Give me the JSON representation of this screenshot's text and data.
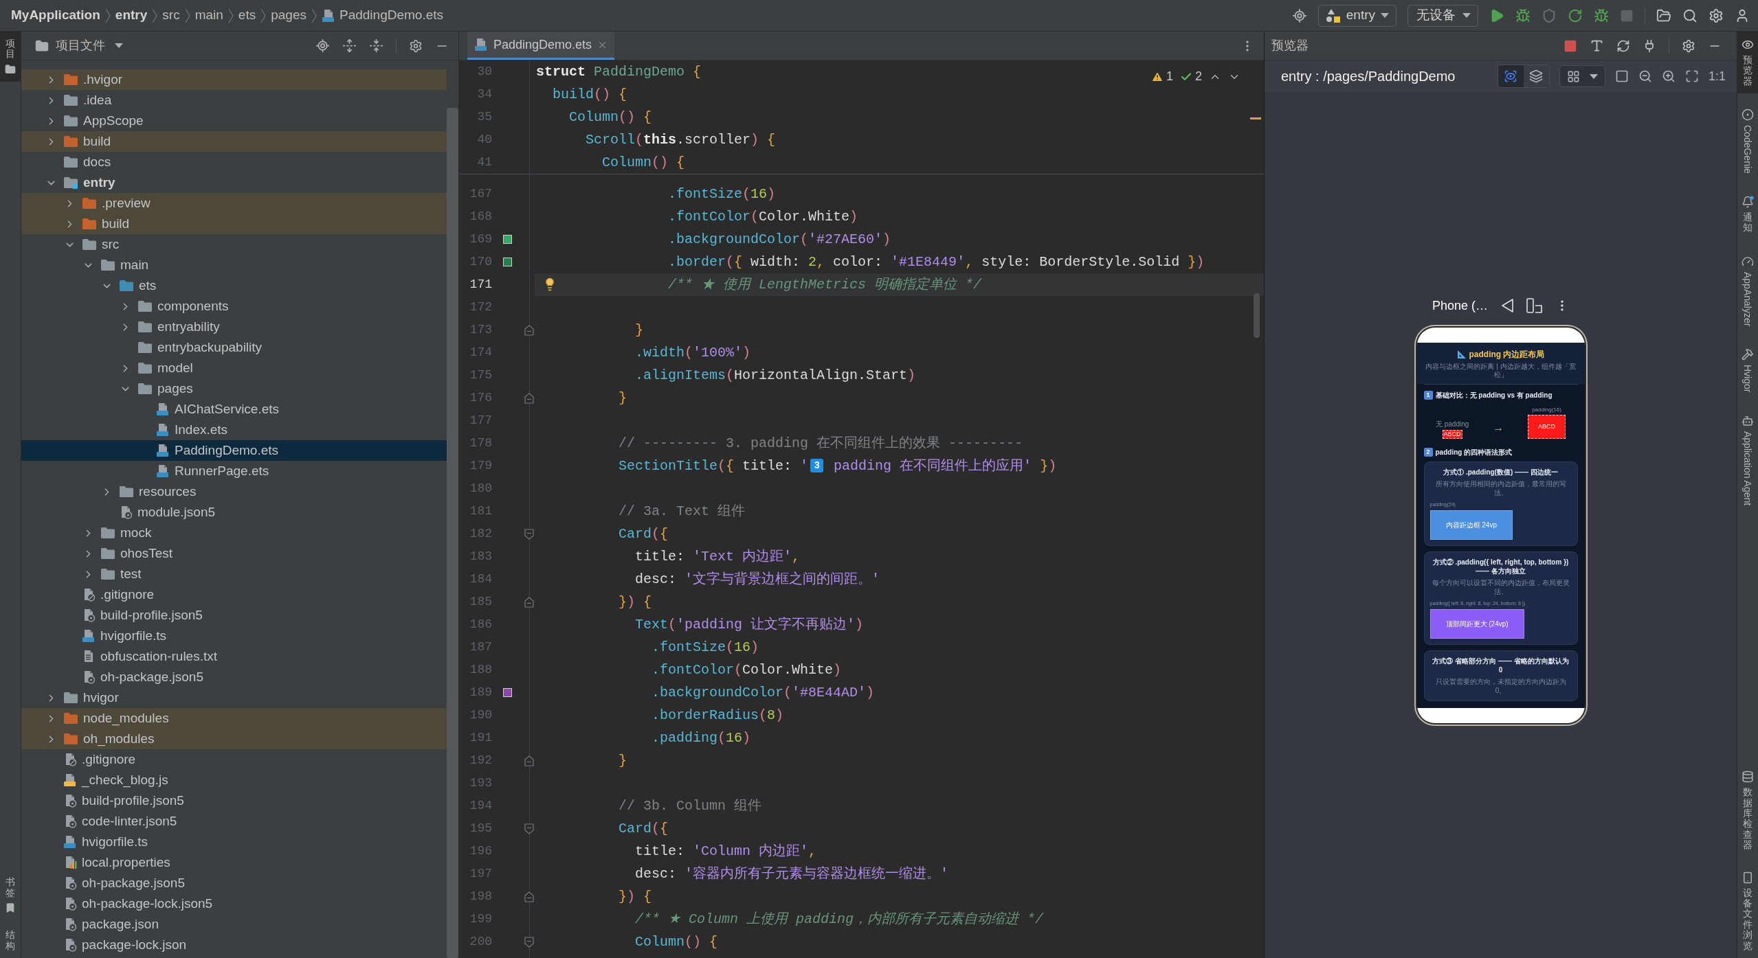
{
  "breadcrumb": [
    {
      "label": "MyApplication",
      "kind": "project"
    },
    {
      "label": "entry",
      "kind": "module"
    },
    {
      "label": "src",
      "kind": "folder"
    },
    {
      "label": "main",
      "kind": "folder"
    },
    {
      "label": "ets",
      "kind": "folder"
    },
    {
      "label": "pages",
      "kind": "folder"
    },
    {
      "label": "PaddingDemo.ets",
      "kind": "ets"
    }
  ],
  "toolbar": {
    "run_config": "entry",
    "device": "无设备"
  },
  "left_strip": {
    "top": [
      {
        "label": "项目",
        "kind": "project",
        "selected": true
      }
    ],
    "bottom": [
      {
        "label": "书签",
        "kind": "bookmark",
        "selected": false
      },
      {
        "label": "结构",
        "kind": "structure",
        "selected": false
      }
    ]
  },
  "project": {
    "title": "项目文件",
    "tree": [
      {
        "label": ".hvigor",
        "kind": "excluded-folder",
        "expanded": false,
        "selected": false
      },
      {
        "label": ".idea",
        "kind": "folder",
        "expanded": false,
        "selected": false
      },
      {
        "label": "AppScope",
        "kind": "folder",
        "expanded": false,
        "selected": false
      },
      {
        "label": "build",
        "kind": "excluded-folder",
        "expanded": false,
        "selected": false
      },
      {
        "label": "docs",
        "kind": "folder",
        "selected": false
      },
      {
        "label": "entry",
        "kind": "module",
        "expanded": true,
        "selected": false,
        "children": [
          {
            "label": ".preview",
            "kind": "excluded-folder",
            "expanded": false,
            "selected": false
          },
          {
            "label": "build",
            "kind": "excluded-folder",
            "expanded": false,
            "selected": false
          },
          {
            "label": "src",
            "kind": "folder",
            "expanded": true,
            "selected": false,
            "children": [
              {
                "label": "main",
                "kind": "folder",
                "expanded": true,
                "selected": false,
                "children": [
                  {
                    "label": "ets",
                    "kind": "source-folder",
                    "expanded": true,
                    "selected": false,
                    "children": [
                      {
                        "label": "components",
                        "kind": "folder",
                        "expanded": false,
                        "selected": false
                      },
                      {
                        "label": "entryability",
                        "kind": "folder",
                        "expanded": false,
                        "selected": false
                      },
                      {
                        "label": "entrybackupability",
                        "kind": "folder",
                        "selected": false
                      },
                      {
                        "label": "model",
                        "kind": "folder",
                        "expanded": false,
                        "selected": false
                      },
                      {
                        "label": "pages",
                        "kind": "folder",
                        "expanded": true,
                        "selected": false,
                        "children": [
                          {
                            "label": "AIChatService.ets",
                            "kind": "ets",
                            "selected": false
                          },
                          {
                            "label": "Index.ets",
                            "kind": "ets",
                            "selected": false
                          },
                          {
                            "label": "PaddingDemo.ets",
                            "kind": "ets",
                            "selected": true
                          },
                          {
                            "label": "RunnerPage.ets",
                            "kind": "ets",
                            "selected": false
                          }
                        ]
                      }
                    ]
                  },
                  {
                    "label": "resources",
                    "kind": "folder",
                    "expanded": false,
                    "selected": false
                  },
                  {
                    "label": "module.json5",
                    "kind": "json5",
                    "selected": false
                  }
                ]
              },
              {
                "label": "mock",
                "kind": "folder",
                "expanded": false,
                "selected": false
              },
              {
                "label": "ohosTest",
                "kind": "folder",
                "expanded": false,
                "selected": false
              },
              {
                "label": "test",
                "kind": "folder",
                "expanded": false,
                "selected": false
              }
            ]
          },
          {
            "label": ".gitignore",
            "kind": "gitignore",
            "selected": false
          },
          {
            "label": "build-profile.json5",
            "kind": "json5",
            "selected": false
          },
          {
            "label": "hvigorfile.ts",
            "kind": "ts",
            "selected": false
          },
          {
            "label": "obfuscation-rules.txt",
            "kind": "txt",
            "selected": false
          },
          {
            "label": "oh-package.json5",
            "kind": "json5",
            "selected": false
          }
        ]
      },
      {
        "label": "hvigor",
        "kind": "folder",
        "expanded": false,
        "selected": false
      },
      {
        "label": "node_modules",
        "kind": "excluded-folder",
        "expanded": false,
        "selected": false
      },
      {
        "label": "oh_modules",
        "kind": "excluded-folder",
        "expanded": false,
        "selected": false
      },
      {
        "label": ".gitignore",
        "kind": "gitignore",
        "selected": false
      },
      {
        "label": "_check_blog.js",
        "kind": "js",
        "selected": false
      },
      {
        "label": "build-profile.json5",
        "kind": "json5",
        "selected": false
      },
      {
        "label": "code-linter.json5",
        "kind": "json5",
        "selected": false
      },
      {
        "label": "hvigorfile.ts",
        "kind": "ts",
        "selected": false
      },
      {
        "label": "local.properties",
        "kind": "properties",
        "selected": false
      },
      {
        "label": "oh-package.json5",
        "kind": "json5",
        "selected": false
      },
      {
        "label": "oh-package-lock.json5",
        "kind": "json5",
        "selected": false
      },
      {
        "label": "package.json",
        "kind": "json5",
        "selected": false
      },
      {
        "label": "package-lock.json",
        "kind": "json5",
        "selected": false
      }
    ]
  },
  "editor": {
    "tab": {
      "label": "PaddingDemo.ets",
      "selected": true
    },
    "inspections": {
      "warnings": "1",
      "passed": "2"
    },
    "sticky_lines": [
      {
        "number": "30",
        "tokens": [
          {
            "text": "struct ",
            "kind": "kw"
          },
          {
            "text": "PaddingDemo ",
            "kind": "type"
          },
          {
            "text": "{",
            "kind": "brace"
          }
        ]
      },
      {
        "number": "34",
        "tokens": [
          {
            "text": "  build",
            "kind": "fn"
          },
          {
            "text": "() ",
            "kind": "paren"
          },
          {
            "text": "{",
            "kind": "brace"
          }
        ]
      },
      {
        "number": "35",
        "tokens": [
          {
            "text": "    Column",
            "kind": "fn"
          },
          {
            "text": "() ",
            "kind": "paren"
          },
          {
            "text": "{",
            "kind": "brace"
          }
        ]
      },
      {
        "number": "40",
        "tokens": [
          {
            "text": "      Scroll",
            "kind": "fn"
          },
          {
            "text": "(",
            "kind": "paren"
          },
          {
            "text": "this",
            "kind": "kw"
          },
          {
            "text": ".scroller",
            "kind": "plain"
          },
          {
            "text": ") ",
            "kind": "paren"
          },
          {
            "text": "{",
            "kind": "brace"
          }
        ]
      },
      {
        "number": "41",
        "tokens": [
          {
            "text": "        Column",
            "kind": "fn"
          },
          {
            "text": "() ",
            "kind": "paren"
          },
          {
            "text": "{",
            "kind": "brace"
          }
        ]
      }
    ],
    "lines": [
      {
        "number": "167",
        "current": false,
        "tokens": [
          {
            "text": "                .fontSize",
            "kind": "fn"
          },
          {
            "text": "(",
            "kind": "paren"
          },
          {
            "text": "16",
            "kind": "num"
          },
          {
            "text": ")",
            "kind": "paren"
          }
        ]
      },
      {
        "number": "168",
        "current": false,
        "tokens": [
          {
            "text": "                .fontColor",
            "kind": "fn"
          },
          {
            "text": "(",
            "kind": "paren"
          },
          {
            "text": "Color.White",
            "kind": "plain"
          },
          {
            "text": ")",
            "kind": "paren"
          }
        ]
      },
      {
        "number": "169",
        "current": false,
        "color": "#27ae60",
        "tokens": [
          {
            "text": "                .backgroundColor",
            "kind": "fn"
          },
          {
            "text": "(",
            "kind": "paren"
          },
          {
            "text": "'#27AE60'",
            "kind": "str"
          },
          {
            "text": ")",
            "kind": "paren"
          }
        ]
      },
      {
        "number": "170",
        "current": false,
        "color": "#1e8449",
        "tokens": [
          {
            "text": "                .border",
            "kind": "fn"
          },
          {
            "text": "(",
            "kind": "paren"
          },
          {
            "text": "{ ",
            "kind": "brace"
          },
          {
            "text": "width: ",
            "kind": "plain"
          },
          {
            "text": "2",
            "kind": "num"
          },
          {
            "text": ", ",
            "kind": "brace"
          },
          {
            "text": "color: ",
            "kind": "plain"
          },
          {
            "text": "'#1E8449'",
            "kind": "str"
          },
          {
            "text": ", ",
            "kind": "brace"
          },
          {
            "text": "style: ",
            "kind": "plain"
          },
          {
            "text": "BorderStyle.Solid ",
            "kind": "plain"
          },
          {
            "text": "}",
            "kind": "brace"
          },
          {
            "text": ")",
            "kind": "paren"
          }
        ]
      },
      {
        "number": "171",
        "current": true,
        "tokens": [
          {
            "text": "                /** ★ 使用 LengthMetrics 明确指定单位 */",
            "kind": "doc"
          }
        ]
      },
      {
        "number": "172",
        "current": false
      },
      {
        "number": "173",
        "current": false,
        "fold": {
          "kind": "end"
        },
        "tokens": [
          {
            "text": "            }",
            "kind": "brace"
          }
        ]
      },
      {
        "number": "174",
        "current": false,
        "tokens": [
          {
            "text": "            .width",
            "kind": "fn"
          },
          {
            "text": "(",
            "kind": "paren"
          },
          {
            "text": "'100%'",
            "kind": "str"
          },
          {
            "text": ")",
            "kind": "paren"
          }
        ]
      },
      {
        "number": "175",
        "current": false,
        "tokens": [
          {
            "text": "            .alignItems",
            "kind": "fn"
          },
          {
            "text": "(",
            "kind": "paren"
          },
          {
            "text": "HorizontalAlign.Start",
            "kind": "plain"
          },
          {
            "text": ")",
            "kind": "paren"
          }
        ]
      },
      {
        "number": "176",
        "current": false,
        "fold": {
          "kind": "end"
        },
        "tokens": [
          {
            "text": "          }",
            "kind": "brace"
          }
        ]
      },
      {
        "number": "177",
        "current": false
      },
      {
        "number": "178",
        "current": false,
        "tokens": [
          {
            "text": "          // --------- 3. padding 在不同组件上的效果 ---------",
            "kind": "comment"
          }
        ]
      },
      {
        "number": "179",
        "current": false,
        "tokens": [
          {
            "text": "          SectionTitle",
            "kind": "fn"
          },
          {
            "text": "(",
            "kind": "paren"
          },
          {
            "text": "{ ",
            "kind": "brace"
          },
          {
            "text": "title: ",
            "kind": "plain"
          },
          {
            "text": "'",
            "kind": "str"
          },
          {
            "text": "3",
            "kind": "keycap"
          },
          {
            "text": " padding 在不同组件上的应用'",
            "kind": "str"
          },
          {
            "text": " }",
            "kind": "brace"
          },
          {
            "text": ")",
            "kind": "paren"
          }
        ]
      },
      {
        "number": "180",
        "current": false
      },
      {
        "number": "181",
        "current": false,
        "tokens": [
          {
            "text": "          // 3a. Text 组件",
            "kind": "comment"
          }
        ]
      },
      {
        "number": "182",
        "current": false,
        "fold": {
          "kind": "start"
        },
        "tokens": [
          {
            "text": "          Card",
            "kind": "fn"
          },
          {
            "text": "(",
            "kind": "paren"
          },
          {
            "text": "{",
            "kind": "brace"
          }
        ]
      },
      {
        "number": "183",
        "current": false,
        "tokens": [
          {
            "text": "            title: ",
            "kind": "plain"
          },
          {
            "text": "'Text 内边距'",
            "kind": "str"
          },
          {
            "text": ",",
            "kind": "brace"
          }
        ]
      },
      {
        "number": "184",
        "current": false,
        "tokens": [
          {
            "text": "            desc: ",
            "kind": "plain"
          },
          {
            "text": "'文字与背景边框之间的间距。'",
            "kind": "str"
          }
        ]
      },
      {
        "number": "185",
        "current": false,
        "fold": {
          "kind": "end"
        },
        "tokens": [
          {
            "text": "          }",
            "kind": "brace"
          },
          {
            "text": ") ",
            "kind": "paren"
          },
          {
            "text": "{",
            "kind": "brace"
          }
        ]
      },
      {
        "number": "186",
        "current": false,
        "tokens": [
          {
            "text": "            Text",
            "kind": "fn"
          },
          {
            "text": "(",
            "kind": "paren"
          },
          {
            "text": "'padding 让文字不再贴边'",
            "kind": "str"
          },
          {
            "text": ")",
            "kind": "paren"
          }
        ]
      },
      {
        "number": "187",
        "current": false,
        "tokens": [
          {
            "text": "              .fontSize",
            "kind": "fn"
          },
          {
            "text": "(",
            "kind": "paren"
          },
          {
            "text": "16",
            "kind": "num"
          },
          {
            "text": ")",
            "kind": "paren"
          }
        ]
      },
      {
        "number": "188",
        "current": false,
        "tokens": [
          {
            "text": "              .fontColor",
            "kind": "fn"
          },
          {
            "text": "(",
            "kind": "paren"
          },
          {
            "text": "Color.White",
            "kind": "plain"
          },
          {
            "text": ")",
            "kind": "paren"
          }
        ]
      },
      {
        "number": "189",
        "current": false,
        "color": "#8e44ad",
        "tokens": [
          {
            "text": "              .backgroundColor",
            "kind": "fn"
          },
          {
            "text": "(",
            "kind": "paren"
          },
          {
            "text": "'#8E44AD'",
            "kind": "str"
          },
          {
            "text": ")",
            "kind": "paren"
          }
        ]
      },
      {
        "number": "190",
        "current": false,
        "tokens": [
          {
            "text": "              .borderRadius",
            "kind": "fn"
          },
          {
            "text": "(",
            "kind": "paren"
          },
          {
            "text": "8",
            "kind": "num"
          },
          {
            "text": ")",
            "kind": "paren"
          }
        ]
      },
      {
        "number": "191",
        "current": false,
        "tokens": [
          {
            "text": "              .padding",
            "kind": "fn"
          },
          {
            "text": "(",
            "kind": "paren"
          },
          {
            "text": "16",
            "kind": "num"
          },
          {
            "text": ")",
            "kind": "paren"
          }
        ]
      },
      {
        "number": "192",
        "current": false,
        "fold": {
          "kind": "end"
        },
        "tokens": [
          {
            "text": "          }",
            "kind": "brace"
          }
        ]
      },
      {
        "number": "193",
        "current": false
      },
      {
        "number": "194",
        "current": false,
        "tokens": [
          {
            "text": "          // 3b. Column 组件",
            "kind": "comment"
          }
        ]
      },
      {
        "number": "195",
        "current": false,
        "fold": {
          "kind": "start"
        },
        "tokens": [
          {
            "text": "          Card",
            "kind": "fn"
          },
          {
            "text": "(",
            "kind": "paren"
          },
          {
            "text": "{",
            "kind": "brace"
          }
        ]
      },
      {
        "number": "196",
        "current": false,
        "tokens": [
          {
            "text": "            title: ",
            "kind": "plain"
          },
          {
            "text": "'Column 内边距'",
            "kind": "str"
          },
          {
            "text": ",",
            "kind": "brace"
          }
        ]
      },
      {
        "number": "197",
        "current": false,
        "tokens": [
          {
            "text": "            desc: ",
            "kind": "plain"
          },
          {
            "text": "'容器内所有子元素与容器边框统一缩进。'",
            "kind": "str"
          }
        ]
      },
      {
        "number": "198",
        "current": false,
        "fold": {
          "kind": "end"
        },
        "tokens": [
          {
            "text": "          }",
            "kind": "brace"
          },
          {
            "text": ") ",
            "kind": "paren"
          },
          {
            "text": "{",
            "kind": "brace"
          }
        ]
      },
      {
        "number": "199",
        "current": false,
        "tokens": [
          {
            "text": "            /** ★ Column 上使用 padding，内部所有子元素自动缩进 */",
            "kind": "doc"
          }
        ]
      },
      {
        "number": "200",
        "current": false,
        "fold": {
          "kind": "start"
        },
        "tokens": [
          {
            "text": "            Column",
            "kind": "fn"
          },
          {
            "text": "() ",
            "kind": "paren"
          },
          {
            "text": "{",
            "kind": "brace"
          }
        ]
      }
    ]
  },
  "preview": {
    "title": "预览器",
    "route": "entry : /pages/PaddingDemo",
    "view_modes": [
      {
        "kind": "inspect",
        "selected": true
      },
      {
        "kind": "layers",
        "selected": false
      }
    ],
    "scale": "1:1",
    "device": {
      "name": "Phone (…",
      "app": {
        "title": "padding 内边距布局",
        "subtitle": "内容与边框之间的距离 | 内边距越大，组件越「宽松」",
        "sections": [
          {
            "kind": "compare",
            "badge": "1",
            "title": "基础对比：无 padding vs 有 padding",
            "before": {
              "label": "无 padding",
              "box": "ABCD"
            },
            "arrow": "→",
            "after": {
              "label": "padding(16)",
              "box": "ABCD"
            }
          },
          {
            "kind": "cards",
            "badge": "2",
            "title": "padding 的四种语法形式",
            "cards": [
              {
                "title": "方式① .padding(数值) —— 四边统一",
                "desc": "所有方向使用相同的内边距值，最常用的写法。",
                "code": "padding(24)",
                "demo": "内容距边框 24vp",
                "color": "#4a8fe0"
              },
              {
                "title": "方式② .padding({ left, right, top, bottom }) —— 各方向独立",
                "desc": "每个方向可以设置不同的内边距值，布局更灵活。",
                "code": "padding({ left: 8, right: 8, top: 24, bottom: 8 })",
                "demo": "顶部间距更大 (24vp)",
                "color": "#8b5cf6"
              },
              {
                "title": "方式③ 省略部分方向 —— 省略的方向默认为 0",
                "desc": "只设置需要的方向，未指定的方向内边距为 0。"
              }
            ]
          }
        ]
      }
    }
  },
  "right_strip": {
    "top": [
      {
        "label": "预览器",
        "kind": "preview",
        "selected": true
      },
      {
        "label": "CodeGenie",
        "kind": "genie",
        "selected": false
      },
      {
        "label": "通知",
        "kind": "notifications",
        "selected": false
      },
      {
        "label": "AppAnalyzer",
        "kind": "analyzer",
        "selected": false
      },
      {
        "label": "Hvigor",
        "kind": "hvigor",
        "selected": false
      },
      {
        "label": "Application Agent",
        "kind": "agent",
        "selected": false
      }
    ],
    "bottom": [
      {
        "label": "数据库检查器",
        "kind": "database",
        "selected": false
      },
      {
        "label": "设备文件浏览",
        "kind": "device",
        "selected": false
      }
    ]
  }
}
